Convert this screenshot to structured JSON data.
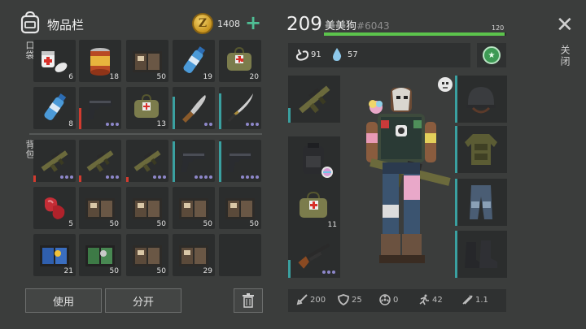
{
  "inventory": {
    "title": "物品栏",
    "coins": "1408",
    "coin_symbol": "Z",
    "add_symbol": "+",
    "pocket_label": "口袋",
    "backpack_label": "背包",
    "pocket_items": [
      {
        "icon": "pills-icon",
        "count": "6"
      },
      {
        "icon": "canned-food-icon",
        "count": "18"
      },
      {
        "icon": "book-icon",
        "count": "50"
      },
      {
        "icon": "water-bottle-icon",
        "count": "19"
      },
      {
        "icon": "first-aid-bag-icon",
        "count": "20"
      },
      {
        "icon": "water-bottle-icon",
        "count": "8"
      },
      {
        "icon": "pistol-icon",
        "count": ""
      },
      {
        "icon": "first-aid-bag-icon",
        "count": "13"
      },
      {
        "icon": "machete-icon",
        "count": ""
      },
      {
        "icon": "katana-icon",
        "count": ""
      }
    ],
    "backpack_items": [
      {
        "icon": "rifle-icon",
        "count": ""
      },
      {
        "icon": "rifle-icon",
        "count": ""
      },
      {
        "icon": "rifle-icon",
        "count": ""
      },
      {
        "icon": "pistol-icon",
        "count": ""
      },
      {
        "icon": "pistol-icon",
        "count": ""
      },
      {
        "icon": "raw-meat-icon",
        "count": "5"
      },
      {
        "icon": "book-icon",
        "count": "50"
      },
      {
        "icon": "book-icon",
        "count": "50"
      },
      {
        "icon": "book-icon",
        "count": "50"
      },
      {
        "icon": "book-icon",
        "count": "50"
      },
      {
        "icon": "blue-book-icon",
        "count": "21"
      },
      {
        "icon": "green-book-icon",
        "count": "50"
      },
      {
        "icon": "book-icon",
        "count": "50"
      },
      {
        "icon": "book-icon",
        "count": "29"
      },
      {
        "icon": "empty",
        "count": ""
      }
    ],
    "use_label": "使用",
    "split_label": "分开"
  },
  "player": {
    "level": "209",
    "name": "美美狗",
    "id": "#6043",
    "xp": "120",
    "xp_fraction": 0.99,
    "hunger": "91",
    "thirst": "57"
  },
  "equipment": {
    "left": [
      {
        "icon": "assault-rifle-icon",
        "count": ""
      },
      {
        "icon": "backpack-icon",
        "count": ""
      },
      {
        "icon": "first-aid-bag-icon",
        "count": "11"
      },
      {
        "icon": "shotgun-icon",
        "count": ""
      }
    ],
    "right": [
      {
        "icon": "helmet-icon"
      },
      {
        "icon": "armor-vest-icon"
      },
      {
        "icon": "pants-icon"
      },
      {
        "icon": "boots-icon"
      }
    ]
  },
  "stats": {
    "attack": "200",
    "defense": "25",
    "radiation": "0",
    "speed": "42",
    "stealth": "1.1"
  },
  "close_label": "关闭",
  "colors": {
    "accent_green": "#5cc44c",
    "durability": "#3aa0a0",
    "rarity_dot": "#8d87c9"
  }
}
